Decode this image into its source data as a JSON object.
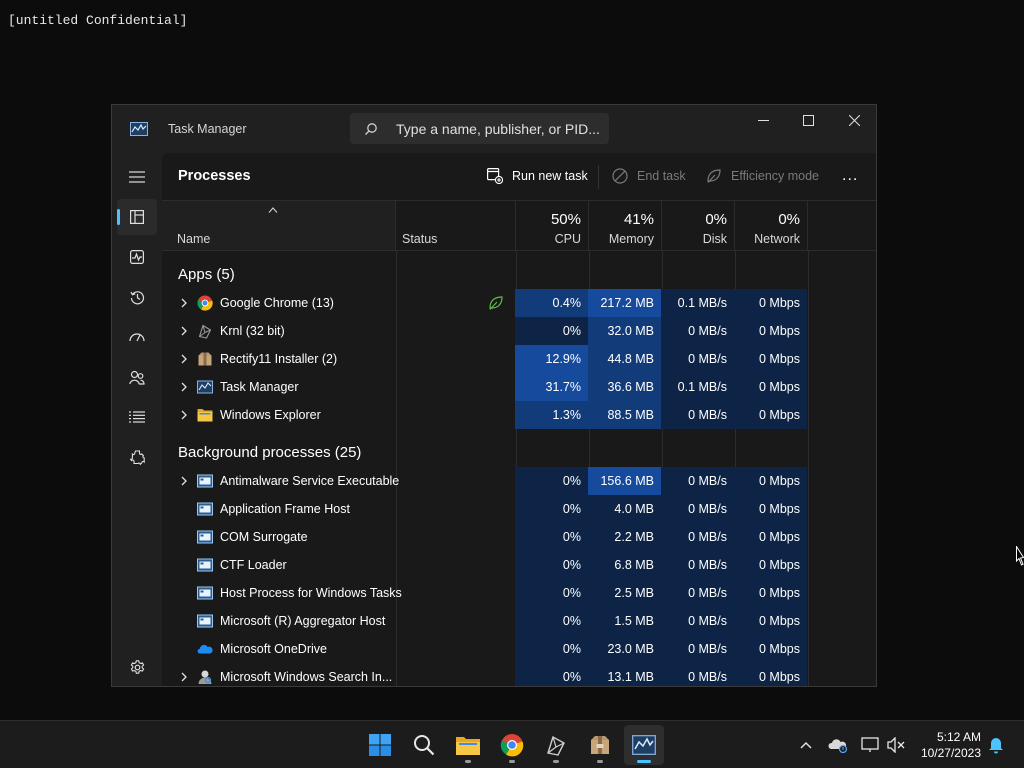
{
  "desktop": {
    "label": "[untitled Confidential]"
  },
  "window": {
    "title": "Task Manager",
    "search_placeholder": "Type a name, publisher, or PID...",
    "controls": [
      "minimize",
      "maximize",
      "close"
    ]
  },
  "nav": {
    "items": [
      "hamburger-menu",
      "processes",
      "performance",
      "app-history",
      "startup-apps",
      "users",
      "details",
      "services",
      "settings"
    ],
    "active": "processes"
  },
  "page": {
    "title": "Processes",
    "run_new_task": "Run new task",
    "end_task": "End task",
    "efficiency_mode": "Efficiency mode",
    "more": "..."
  },
  "columns": {
    "name": "Name",
    "status": "Status",
    "cpu_pct": "50%",
    "cpu": "CPU",
    "memory_pct": "41%",
    "memory": "Memory",
    "disk_pct": "0%",
    "disk": "Disk",
    "network_pct": "0%",
    "network": "Network"
  },
  "groups": {
    "apps": "Apps (5)",
    "background": "Background processes (25)"
  },
  "apps": [
    {
      "name": "Google Chrome (13)",
      "icon": "chrome-icon",
      "expandable": true,
      "efficiency": true,
      "cpu": "0.4%",
      "memory": "217.2 MB",
      "disk": "0.1 MB/s",
      "network": "0 Mbps"
    },
    {
      "name": "Krnl (32 bit)",
      "icon": "krnl-icon",
      "expandable": true,
      "efficiency": false,
      "cpu": "0%",
      "memory": "32.0 MB",
      "disk": "0 MB/s",
      "network": "0 Mbps"
    },
    {
      "name": "Rectify11 Installer (2)",
      "icon": "installer-icon",
      "expandable": true,
      "efficiency": false,
      "cpu": "12.9%",
      "memory": "44.8 MB",
      "disk": "0 MB/s",
      "network": "0 Mbps"
    },
    {
      "name": "Task Manager",
      "icon": "task-manager-icon",
      "expandable": true,
      "efficiency": false,
      "cpu": "31.7%",
      "memory": "36.6 MB",
      "disk": "0.1 MB/s",
      "network": "0 Mbps"
    },
    {
      "name": "Windows Explorer",
      "icon": "folder-icon",
      "expandable": true,
      "efficiency": false,
      "cpu": "1.3%",
      "memory": "88.5 MB",
      "disk": "0 MB/s",
      "network": "0 Mbps"
    }
  ],
  "background": [
    {
      "name": "Antimalware Service Executable",
      "icon": "service-icon",
      "expandable": true,
      "cpu": "0%",
      "memory": "156.6 MB",
      "disk": "0 MB/s",
      "network": "0 Mbps"
    },
    {
      "name": "Application Frame Host",
      "icon": "service-icon",
      "expandable": false,
      "cpu": "0%",
      "memory": "4.0 MB",
      "disk": "0 MB/s",
      "network": "0 Mbps"
    },
    {
      "name": "COM Surrogate",
      "icon": "service-icon",
      "expandable": false,
      "cpu": "0%",
      "memory": "2.2 MB",
      "disk": "0 MB/s",
      "network": "0 Mbps"
    },
    {
      "name": "CTF Loader",
      "icon": "service-icon",
      "expandable": false,
      "cpu": "0%",
      "memory": "6.8 MB",
      "disk": "0 MB/s",
      "network": "0 Mbps"
    },
    {
      "name": "Host Process for Windows Tasks",
      "icon": "service-icon",
      "expandable": false,
      "cpu": "0%",
      "memory": "2.5 MB",
      "disk": "0 MB/s",
      "network": "0 Mbps"
    },
    {
      "name": "Microsoft (R) Aggregator Host",
      "icon": "service-icon",
      "expandable": false,
      "cpu": "0%",
      "memory": "1.5 MB",
      "disk": "0 MB/s",
      "network": "0 Mbps"
    },
    {
      "name": "Microsoft OneDrive",
      "icon": "onedrive-icon",
      "expandable": false,
      "cpu": "0%",
      "memory": "23.0 MB",
      "disk": "0 MB/s",
      "network": "0 Mbps"
    },
    {
      "name": "Microsoft Windows Search In...",
      "icon": "search-indexer-icon",
      "expandable": true,
      "cpu": "0%",
      "memory": "13.1 MB",
      "disk": "0 MB/s",
      "network": "0 Mbps"
    }
  ],
  "taskbar": {
    "apps": [
      "start-icon",
      "search-icon",
      "file-explorer-icon",
      "chrome-icon",
      "krnl-icon",
      "installer-icon",
      "task-manager-icon"
    ],
    "active": "task-manager-icon",
    "time": "5:12 AM",
    "date": "10/27/2023"
  },
  "colors": {
    "heat_low": "#0d2447",
    "heat_med": "#123b7a",
    "heat_high": "#164a9c",
    "accent": "#4cc2ff"
  }
}
